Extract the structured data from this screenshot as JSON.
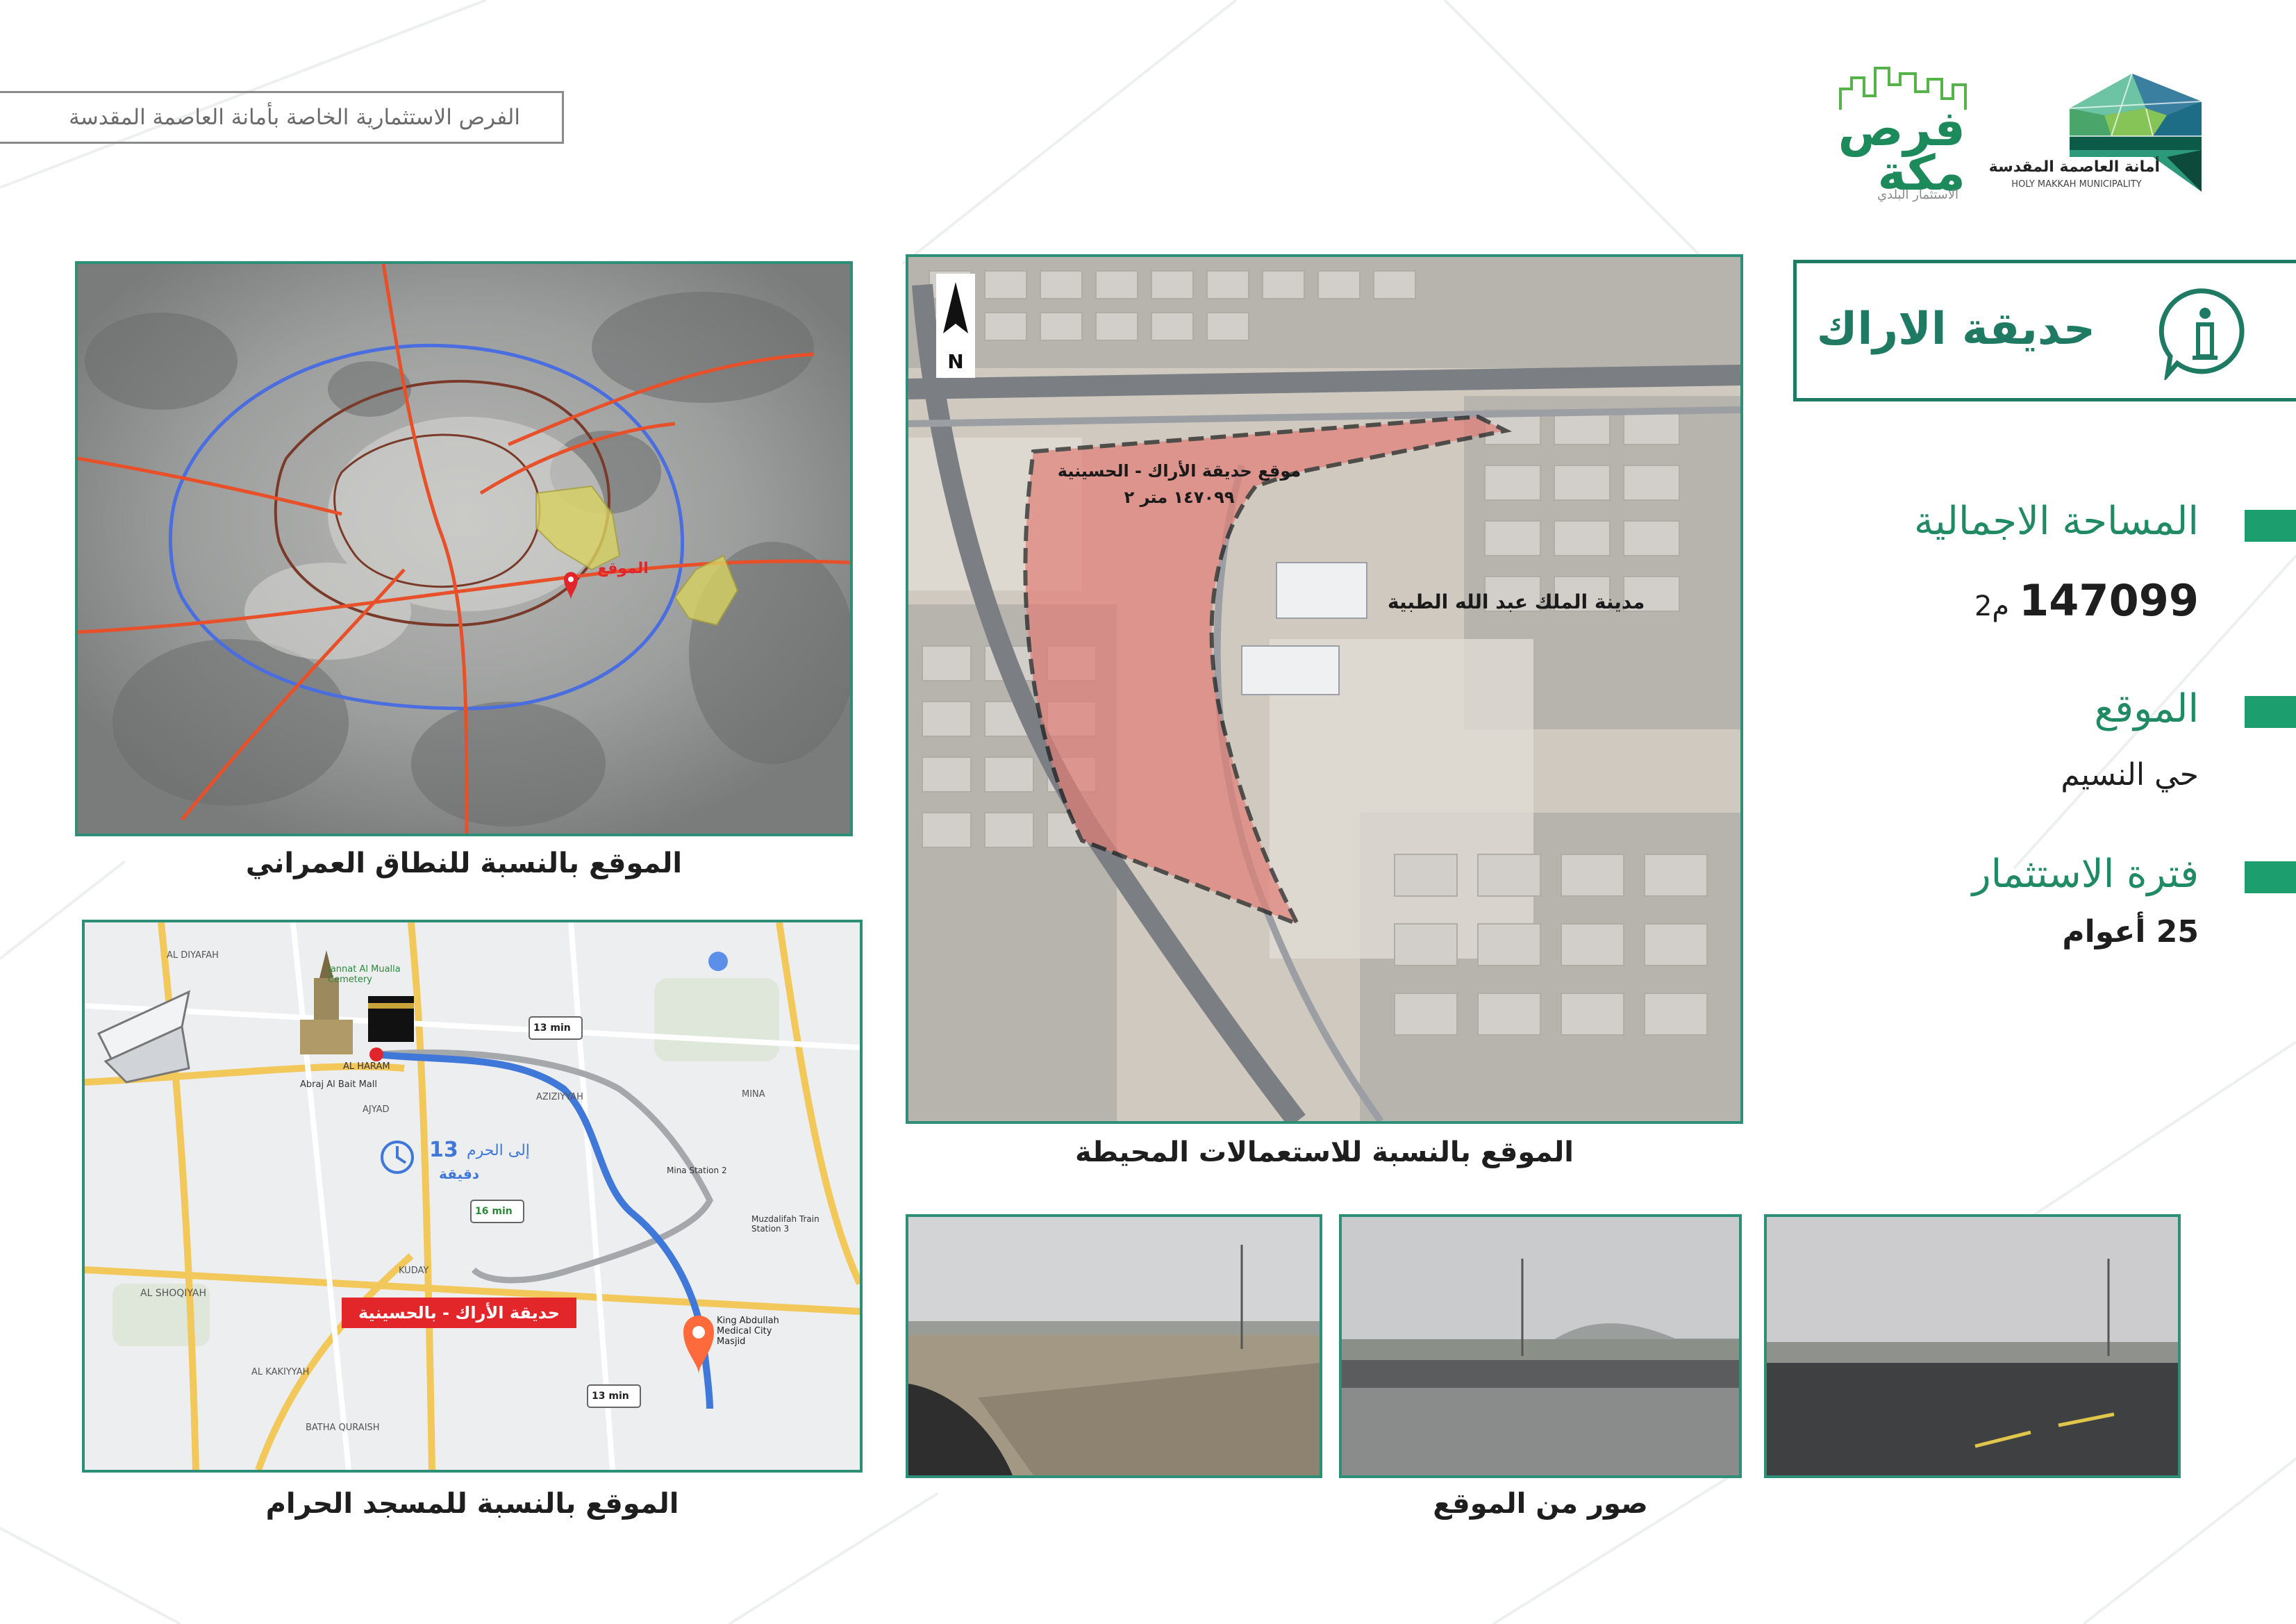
{
  "header": {
    "tagline": "الفرص الاستثمارية الخاصة بأمانة العاصمة المقدسة"
  },
  "logos": {
    "municipality_ar": "أمانة العاصمة المقدسة",
    "municipality_en": "HOLY MAKKAH MUNICIPALITY",
    "furas_line1": "فرص",
    "furas_line2": "مكة",
    "furas_sub": "الاستثمار البلدي"
  },
  "property": {
    "title": "حديقة الاراك",
    "area_label": "المساحة الاجمالية",
    "area_value": "147099",
    "area_unit": "م2",
    "location_label": "الموقع",
    "location_value": "حي النسيم",
    "period_label": "فترة الاستثمار",
    "period_value": "25 أعوام"
  },
  "maps": {
    "urban": {
      "caption": "الموقع بالنسبة للنطاق العمراني",
      "pin_label": "الموقع"
    },
    "aerial": {
      "caption": "الموقع بالنسبة للاستعمالات المحيطة",
      "site_label_line1": "موقع حديقة الأراك - الحسينية",
      "site_label_line2": "١٤٧٠٩٩ متر ٢",
      "neighbor_label": "مدينة الملك عبد الله الطبية",
      "north": "N"
    },
    "haram": {
      "caption": "الموقع بالنسبة للمسجد الحرام",
      "site_tag": "حديقة الأراك - بالحسينية",
      "duration_num": "13",
      "duration_to": "إلى الحرم",
      "duration_unit": "دقيقة",
      "route_badge_1": "13 min",
      "route_badge_2": "16 min",
      "route_badge_3": "13 min",
      "place_diyafah": "AL DIYAFAH",
      "place_haram": "AL HARAM",
      "place_aziziyah": "AZIZIYYAH",
      "place_mina": "MINA",
      "place_shoqiyah": "AL SHOQIYAH",
      "place_kakiyah": "AL KAKIYYAH",
      "place_batha": "BATHA QURAISH",
      "place_kuday": "KUDAY",
      "place_ajyad": "AJYAD",
      "place_abraj": "Abraj Al Bait Mall",
      "place_medical": "King Abdullah Medical City Masjid",
      "place_mina_station": "Mina Station 2",
      "place_muzdalifah": "Muzdalifah Train Station 3",
      "place_mualla": "Jannat Al Mualla Cemetery"
    }
  },
  "photos": {
    "caption": "صور من الموقع"
  },
  "colors": {
    "brand_green": "#1f7a63",
    "bar_green": "#1c9e6e",
    "panel_border": "#2e8f78"
  }
}
